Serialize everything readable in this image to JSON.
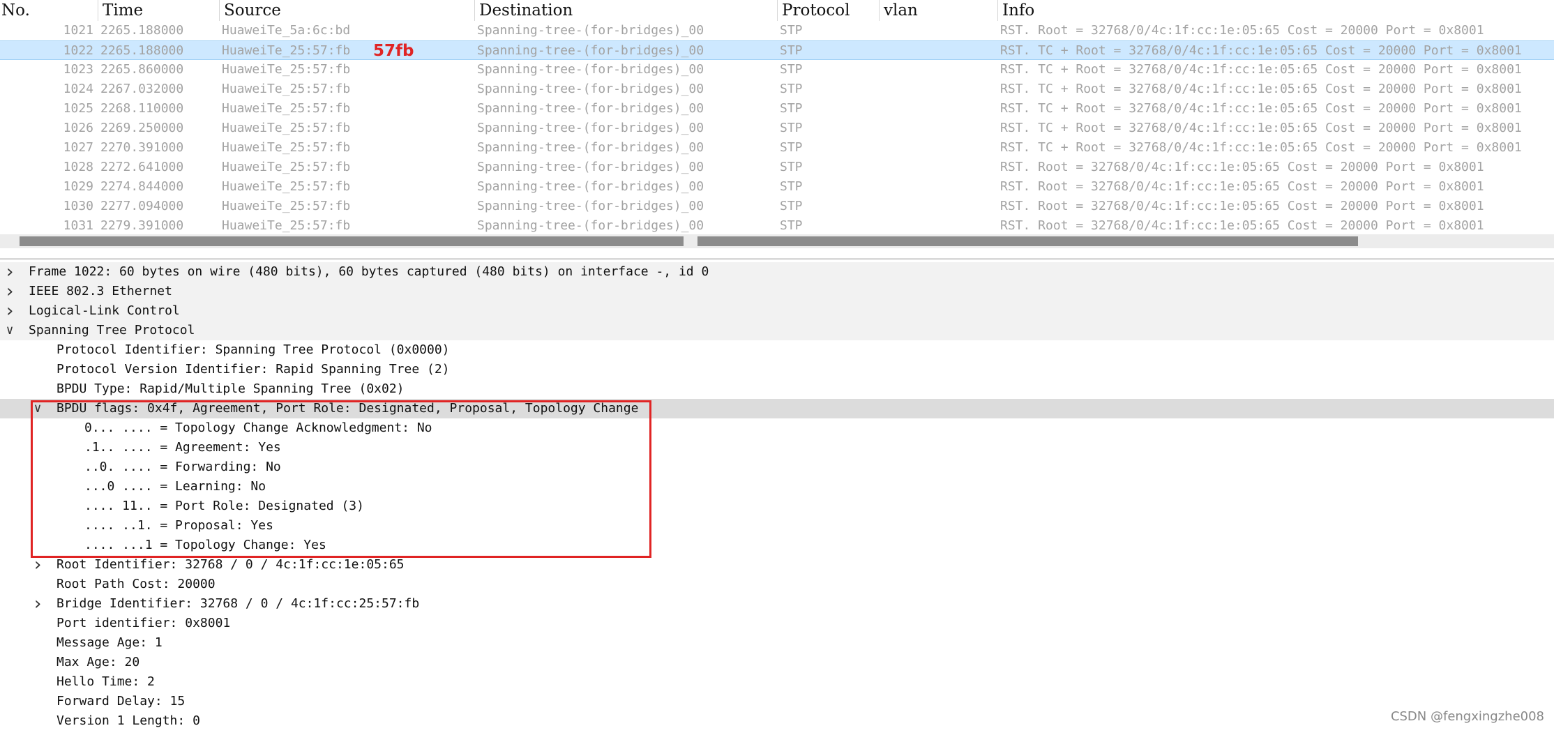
{
  "columns": [
    "No.",
    "Time",
    "Source",
    "Destination",
    "Protocol",
    "vlan",
    "Info"
  ],
  "packets": [
    {
      "no": "1021",
      "time": "2265.188000",
      "source": "HuaweiTe_5a:6c:bd",
      "destination": "Spanning-tree-(for-bridges)_00",
      "protocol": "STP",
      "vlan": "",
      "info": "RST. Root = 32768/0/4c:1f:cc:1e:05:65  Cost = 20000  Port = 0x8001"
    },
    {
      "no": "1022",
      "time": "2265.188000",
      "source": "HuaweiTe_25:57:fb",
      "destination": "Spanning-tree-(for-bridges)_00",
      "protocol": "STP",
      "vlan": "",
      "info": "RST. TC + Root = 32768/0/4c:1f:cc:1e:05:65  Cost = 20000  Port = 0x8001"
    },
    {
      "no": "1023",
      "time": "2265.860000",
      "source": "HuaweiTe_25:57:fb",
      "destination": "Spanning-tree-(for-bridges)_00",
      "protocol": "STP",
      "vlan": "",
      "info": "RST. TC + Root = 32768/0/4c:1f:cc:1e:05:65  Cost = 20000  Port = 0x8001"
    },
    {
      "no": "1024",
      "time": "2267.032000",
      "source": "HuaweiTe_25:57:fb",
      "destination": "Spanning-tree-(for-bridges)_00",
      "protocol": "STP",
      "vlan": "",
      "info": "RST. TC + Root = 32768/0/4c:1f:cc:1e:05:65  Cost = 20000  Port = 0x8001"
    },
    {
      "no": "1025",
      "time": "2268.110000",
      "source": "HuaweiTe_25:57:fb",
      "destination": "Spanning-tree-(for-bridges)_00",
      "protocol": "STP",
      "vlan": "",
      "info": "RST. TC + Root = 32768/0/4c:1f:cc:1e:05:65  Cost = 20000  Port = 0x8001"
    },
    {
      "no": "1026",
      "time": "2269.250000",
      "source": "HuaweiTe_25:57:fb",
      "destination": "Spanning-tree-(for-bridges)_00",
      "protocol": "STP",
      "vlan": "",
      "info": "RST. TC + Root = 32768/0/4c:1f:cc:1e:05:65  Cost = 20000  Port = 0x8001"
    },
    {
      "no": "1027",
      "time": "2270.391000",
      "source": "HuaweiTe_25:57:fb",
      "destination": "Spanning-tree-(for-bridges)_00",
      "protocol": "STP",
      "vlan": "",
      "info": "RST. TC + Root = 32768/0/4c:1f:cc:1e:05:65  Cost = 20000  Port = 0x8001"
    },
    {
      "no": "1028",
      "time": "2272.641000",
      "source": "HuaweiTe_25:57:fb",
      "destination": "Spanning-tree-(for-bridges)_00",
      "protocol": "STP",
      "vlan": "",
      "info": "RST. Root = 32768/0/4c:1f:cc:1e:05:65  Cost = 20000  Port = 0x8001"
    },
    {
      "no": "1029",
      "time": "2274.844000",
      "source": "HuaweiTe_25:57:fb",
      "destination": "Spanning-tree-(for-bridges)_00",
      "protocol": "STP",
      "vlan": "",
      "info": "RST. Root = 32768/0/4c:1f:cc:1e:05:65  Cost = 20000  Port = 0x8001"
    },
    {
      "no": "1030",
      "time": "2277.094000",
      "source": "HuaweiTe_25:57:fb",
      "destination": "Spanning-tree-(for-bridges)_00",
      "protocol": "STP",
      "vlan": "",
      "info": "RST. Root = 32768/0/4c:1f:cc:1e:05:65  Cost = 20000  Port = 0x8001"
    },
    {
      "no": "1031",
      "time": "2279.391000",
      "source": "HuaweiTe_25:57:fb",
      "destination": "Spanning-tree-(for-bridges)_00",
      "protocol": "STP",
      "vlan": "",
      "info": "RST. Root = 32768/0/4c:1f:cc:1e:05:65  Cost = 20000  Port = 0x8001"
    }
  ],
  "selected_packet_no": "1022",
  "annotation_label": "57fb",
  "tree": [
    {
      "level": 0,
      "expander": "collapsed",
      "text": "Frame 1022: 60 bytes on wire (480 bits), 60 bytes captured (480 bits) on interface -, id 0"
    },
    {
      "level": 0,
      "expander": "collapsed",
      "text": "IEEE 802.3 Ethernet"
    },
    {
      "level": 0,
      "expander": "collapsed",
      "text": "Logical-Link Control"
    },
    {
      "level": 0,
      "expander": "expanded",
      "text": "Spanning Tree Protocol"
    },
    {
      "level": 1,
      "expander": "none",
      "text": "Protocol Identifier: Spanning Tree Protocol (0x0000)"
    },
    {
      "level": 1,
      "expander": "none",
      "text": "Protocol Version Identifier: Rapid Spanning Tree (2)"
    },
    {
      "level": 1,
      "expander": "none",
      "text": "BPDU Type: Rapid/Multiple Spanning Tree (0x02)"
    },
    {
      "level": 1,
      "expander": "expanded",
      "highlight": true,
      "text": "BPDU flags: 0x4f, Agreement, Port Role: Designated, Proposal, Topology Change"
    },
    {
      "level": 2,
      "expander": "none",
      "text": "0... .... = Topology Change Acknowledgment: No"
    },
    {
      "level": 2,
      "expander": "none",
      "text": ".1.. .... = Agreement: Yes"
    },
    {
      "level": 2,
      "expander": "none",
      "text": "..0. .... = Forwarding: No"
    },
    {
      "level": 2,
      "expander": "none",
      "text": "...0 .... = Learning: No"
    },
    {
      "level": 2,
      "expander": "none",
      "text": ".... 11.. = Port Role: Designated (3)"
    },
    {
      "level": 2,
      "expander": "none",
      "text": ".... ..1. = Proposal: Yes"
    },
    {
      "level": 2,
      "expander": "none",
      "text": ".... ...1 = Topology Change: Yes"
    },
    {
      "level": 1,
      "expander": "collapsed",
      "text": "Root Identifier: 32768 / 0 / 4c:1f:cc:1e:05:65"
    },
    {
      "level": 1,
      "expander": "none",
      "text": "Root Path Cost: 20000"
    },
    {
      "level": 1,
      "expander": "collapsed",
      "text": "Bridge Identifier: 32768 / 0 / 4c:1f:cc:25:57:fb"
    },
    {
      "level": 1,
      "expander": "none",
      "text": "Port identifier: 0x8001"
    },
    {
      "level": 1,
      "expander": "none",
      "text": "Message Age: 1"
    },
    {
      "level": 1,
      "expander": "none",
      "text": "Max Age: 20"
    },
    {
      "level": 1,
      "expander": "none",
      "text": "Hello Time: 2"
    },
    {
      "level": 1,
      "expander": "none",
      "text": "Forward Delay: 15"
    },
    {
      "level": 1,
      "expander": "none",
      "text": "Version 1 Length: 0"
    }
  ],
  "watermark": "CSDN @fengxingzhe008",
  "colors": {
    "selected_row": "#cde8ff",
    "highlight_row": "#dcdcdc",
    "annotation_red": "#e02424",
    "dim_text": "#a3a3a3"
  }
}
